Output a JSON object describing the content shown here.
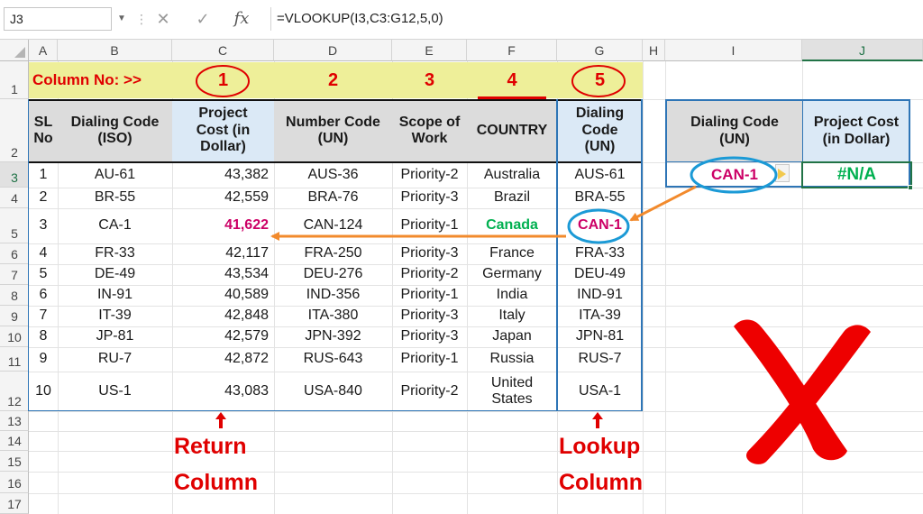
{
  "formula_bar": {
    "name_box": "J3",
    "formula": "=VLOOKUP(I3,C3:G12,5,0)",
    "cancel_icon": "✕",
    "enter_icon": "✓",
    "fx_label": "fx"
  },
  "columns": [
    "A",
    "B",
    "C",
    "D",
    "E",
    "F",
    "G",
    "H",
    "I",
    "J"
  ],
  "rows": [
    "1",
    "2",
    "3",
    "4",
    "5",
    "6",
    "7",
    "8",
    "9",
    "10",
    "11",
    "12",
    "13",
    "14",
    "15",
    "16",
    "17"
  ],
  "banner": {
    "label": "Column No: >>",
    "numbers": [
      "1",
      "2",
      "3",
      "4",
      "5"
    ]
  },
  "table": {
    "headers": [
      "SL No",
      "Dialing Code (ISO)",
      "Project Cost (in Dollar)",
      "Number Code (UN)",
      "Scope of Work",
      "COUNTRY",
      "Dialing Code (UN)"
    ],
    "rows": [
      [
        "1",
        "AU-61",
        "43,382",
        "AUS-36",
        "Priority-2",
        "Australia",
        "AUS-61"
      ],
      [
        "2",
        "BR-55",
        "42,559",
        "BRA-76",
        "Priority-3",
        "Brazil",
        "BRA-55"
      ],
      [
        "3",
        "CA-1",
        "41,622",
        "CAN-124",
        "Priority-1",
        "Canada",
        "CAN-1"
      ],
      [
        "4",
        "FR-33",
        "42,117",
        "FRA-250",
        "Priority-3",
        "France",
        "FRA-33"
      ],
      [
        "5",
        "DE-49",
        "43,534",
        "DEU-276",
        "Priority-2",
        "Germany",
        "DEU-49"
      ],
      [
        "6",
        "IN-91",
        "40,589",
        "IND-356",
        "Priority-1",
        "India",
        "IND-91"
      ],
      [
        "7",
        "IT-39",
        "42,848",
        "ITA-380",
        "Priority-3",
        "Italy",
        "ITA-39"
      ],
      [
        "8",
        "JP-81",
        "42,579",
        "JPN-392",
        "Priority-3",
        "Japan",
        "JPN-81"
      ],
      [
        "9",
        "RU-7",
        "42,872",
        "RUS-643",
        "Priority-1",
        "Russia",
        "RUS-7"
      ],
      [
        "10",
        "US-1",
        "43,083",
        "USA-840",
        "Priority-2",
        "United States",
        "USA-1"
      ]
    ]
  },
  "lookup": {
    "header_key": "Dialing Code (UN)",
    "header_value": "Project Cost (in Dollar)",
    "key": "CAN-1",
    "result": "#N/A"
  },
  "annotations": {
    "return_column": "Return Column",
    "lookup_column": "Lookup Column",
    "cross_icon": "cross-mark-icon"
  },
  "colors": {
    "accent_red": "#e00000",
    "highlight_magenta": "#cc0066",
    "green_text": "#00b050",
    "arrow_orange": "#f28a2c",
    "circle_blue": "#1b9ad6",
    "banner_yellow": "#eeef99",
    "header_gray": "#dcdcdc",
    "header_blue": "#dbe9f6"
  }
}
